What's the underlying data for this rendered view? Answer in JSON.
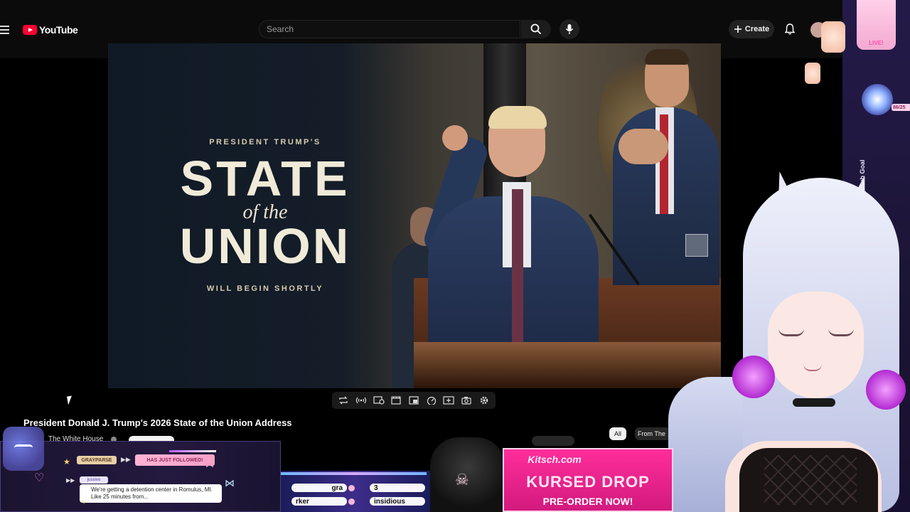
{
  "header": {
    "logo_text": "YouTube",
    "search_placeholder": "Search",
    "create_label": "Create"
  },
  "video": {
    "overlay_pretitle": "PRESIDENT TRUMP'S",
    "overlay_state": "STATE",
    "overlay_ofthe": "of the",
    "overlay_union": "UNION",
    "overlay_posttitle": "WILL BEGIN SHORTLY"
  },
  "meta": {
    "title": "President Donald J. Trump's 2026 State of the Union Address",
    "channel": "The White House",
    "chip_all": "All",
    "chip_from": "From The"
  },
  "stream_overlay": {
    "follower_name": "GRAYPARSE",
    "follow_event": "HAS JUST FOLLOWED!",
    "chat_user": "jussivo",
    "chat_message": "We're getting a detention center in Romulus, MI. Like 25 minutes from...",
    "goal_pill_1": "gra",
    "goal_pill_2": "3",
    "goal_pill_3": "rker",
    "goal_pill_4": "insidious",
    "merch_logo": "Kitsch.com",
    "merch_title": "KURSED DROP",
    "merch_subtitle": "PRE-ORDER NOW!",
    "live_label": "LIVE!",
    "sub_goal_label": "Daily Sub Goal",
    "sub_goal_count": "86/25"
  },
  "colors": {
    "brand_red": "#ff0033",
    "overlay_pink": "#ff2d9b",
    "overlay_purple": "#24193f"
  }
}
